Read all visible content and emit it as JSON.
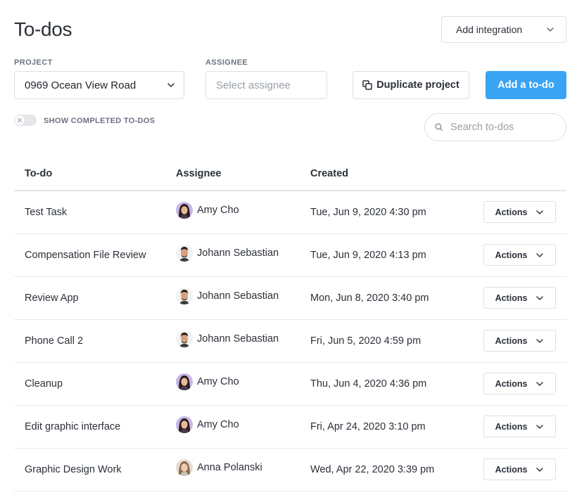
{
  "page": {
    "title": "To-dos"
  },
  "integration": {
    "label": "Add integration"
  },
  "filters": {
    "project_label": "PROJECT",
    "project_value": "0969 Ocean View Road",
    "assignee_label": "ASSIGNEE",
    "assignee_placeholder": "Select assignee"
  },
  "buttons": {
    "duplicate": "Duplicate project",
    "add": "Add a to-do"
  },
  "toggle": {
    "label": "SHOW COMPLETED TO-DOS",
    "on": false
  },
  "search": {
    "placeholder": "Search to-dos"
  },
  "table": {
    "columns": [
      "To-do",
      "Assignee",
      "Created"
    ],
    "rows": [
      {
        "todo": "Test Task",
        "assignee": "Amy Cho",
        "avatar": "avatar-amy",
        "created": "Tue, Jun 9, 2020 4:30 pm",
        "action": "Actions"
      },
      {
        "todo": "Compensation File Review",
        "assignee": "Johann Sebastian",
        "avatar": "avatar-johann",
        "created": "Tue, Jun 9, 2020 4:13 pm",
        "action": "Actions"
      },
      {
        "todo": "Review App",
        "assignee": "Johann Sebastian",
        "avatar": "avatar-johann",
        "created": "Mon, Jun 8, 2020 3:40 pm",
        "action": "Actions"
      },
      {
        "todo": "Phone Call 2",
        "assignee": "Johann Sebastian",
        "avatar": "avatar-johann",
        "created": "Fri, Jun 5, 2020 4:59 pm",
        "action": "Actions"
      },
      {
        "todo": "Cleanup",
        "assignee": "Amy Cho",
        "avatar": "avatar-amy",
        "created": "Thu, Jun 4, 2020 4:36 pm",
        "action": "Actions"
      },
      {
        "todo": "Edit graphic interface",
        "assignee": "Amy Cho",
        "avatar": "avatar-amy",
        "created": "Fri, Apr 24, 2020 3:10 pm",
        "action": "Actions"
      },
      {
        "todo": "Graphic Design Work",
        "assignee": "Anna Polanski",
        "avatar": "avatar-anna",
        "created": "Wed, Apr 22, 2020 3:39 pm",
        "action": "Actions"
      }
    ]
  },
  "colors": {
    "primary": "#3aa3f3",
    "border": "#dcdfe4",
    "text": "#2b3038",
    "muted": "#6b7280"
  }
}
